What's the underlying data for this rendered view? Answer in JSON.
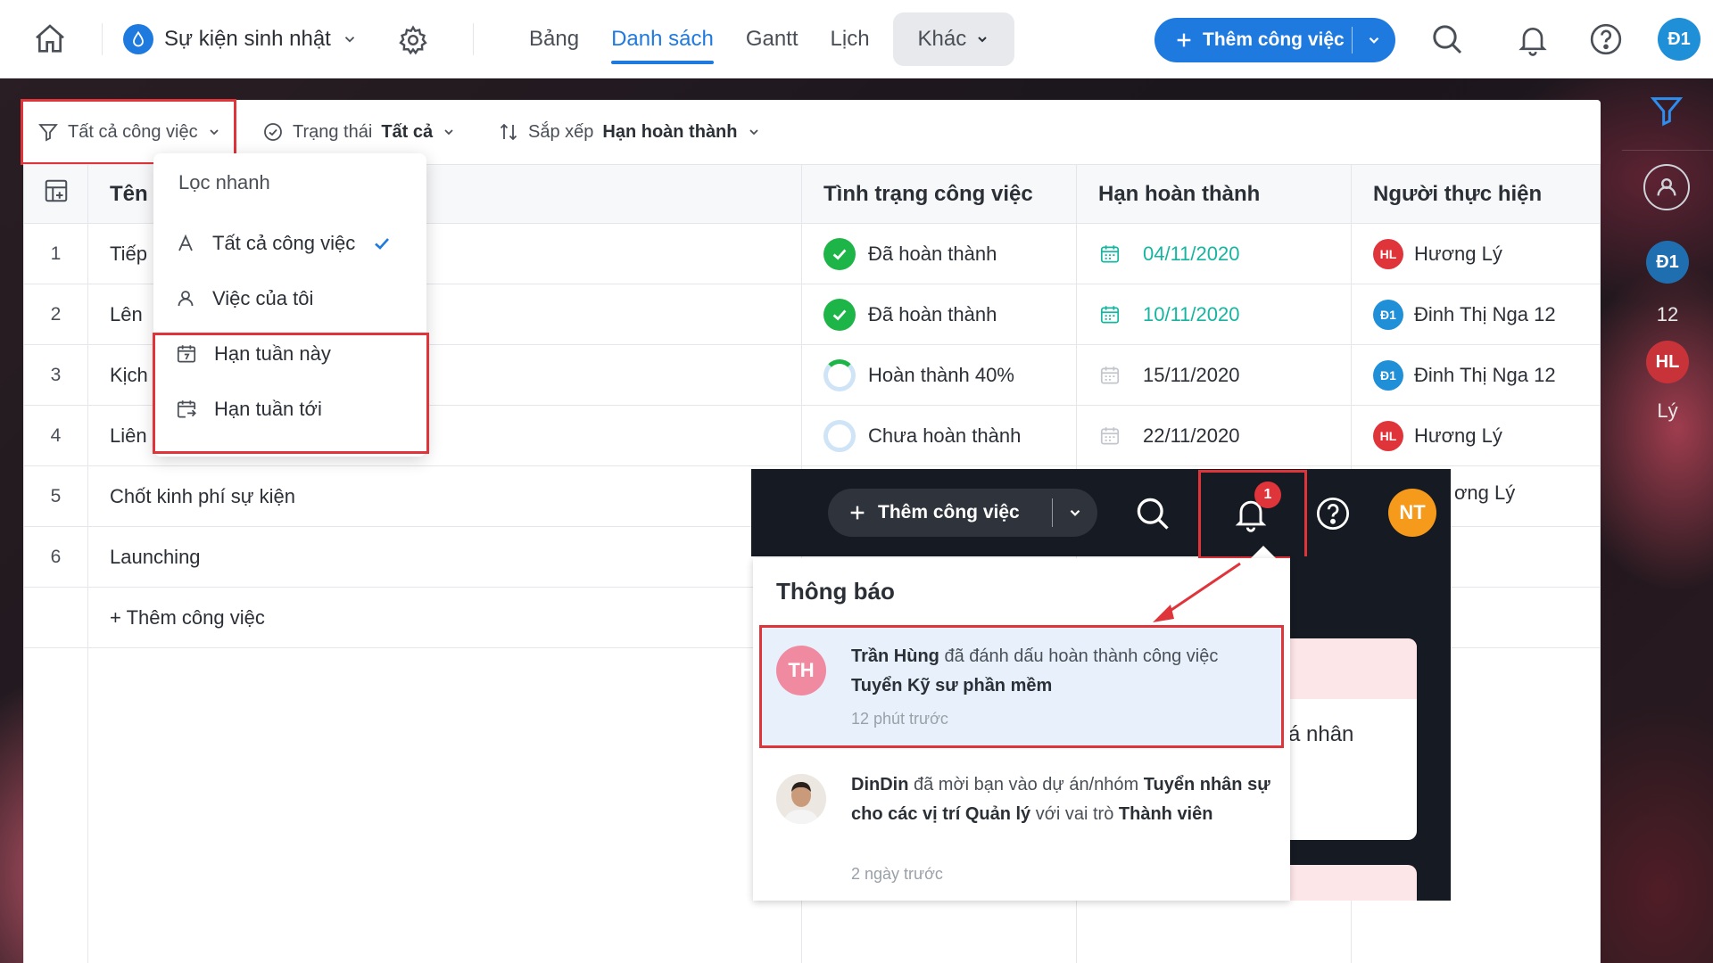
{
  "topbar": {
    "project_name": "Sự kiện sinh nhật",
    "views": [
      "Bảng",
      "Danh sách",
      "Gantt",
      "Lịch"
    ],
    "active_view": "Danh sách",
    "more_label": "Khác",
    "add_task_label": "Thêm công việc",
    "user_initials": "Đ1",
    "accent_color": "#1f7ae0"
  },
  "toolbar": {
    "filter_label": "Tất cả công việc",
    "status_prefix": "Trạng thái",
    "status_value": "Tất cả",
    "sort_prefix": "Sắp xếp",
    "sort_value": "Hạn hoàn thành"
  },
  "table": {
    "columns": {
      "name": "Tên",
      "status": "Tình trạng công việc",
      "due": "Hạn hoàn thành",
      "assignee": "Người thực hiện"
    },
    "rows": [
      {
        "num": "1",
        "name": "Tiếp",
        "status": "Đã hoàn thành",
        "state": "done",
        "due": "04/11/2020",
        "assignee": "Hương Lý",
        "initials": "HL",
        "color": "#e0343b"
      },
      {
        "num": "2",
        "name": "Lên",
        "status": "Đã hoàn thành",
        "state": "done",
        "due": "10/11/2020",
        "assignee": "Đinh Thị Nga 12",
        "initials": "Đ1",
        "color": "#1f8fd8"
      },
      {
        "num": "3",
        "name": "Kịch",
        "status": "Hoàn thành 40%",
        "state": "partial",
        "due": "15/11/2020",
        "assignee": "Đinh Thị Nga 12",
        "initials": "Đ1",
        "color": "#1f8fd8"
      },
      {
        "num": "4",
        "name": "Liên",
        "status": "Chưa hoàn thành",
        "state": "none",
        "due": "22/11/2020",
        "assignee": "Hương Lý",
        "initials": "HL",
        "color": "#e0343b"
      },
      {
        "num": "5",
        "name": "Chốt kinh phí sự kiện"
      },
      {
        "num": "6",
        "name": "Launching"
      }
    ],
    "add_task_link": "+ Thêm công việc"
  },
  "quick_filter": {
    "title": "Lọc nhanh",
    "items": [
      "Tất cả công việc",
      "Việc của tôi",
      "Hạn tuần này",
      "Hạn tuần tới"
    ]
  },
  "rail": {
    "av1_initials": "Đ1",
    "av1_label": "12",
    "av2_initials": "HL",
    "av2_label": "Lý"
  },
  "overlay": {
    "add_task_label": "Thêm công việc",
    "badge_count": "1",
    "user_initials": "NT",
    "peek_assignee": "ơng Lý",
    "peek_text": "á nhân"
  },
  "notifications": {
    "title": "Thông báo",
    "items": [
      {
        "initials": "TH",
        "actor": "Trần Hùng",
        "action": " đã đánh dấu hoàn thành công việc ",
        "target": "Tuyển Kỹ sư phần mềm",
        "time": "12 phút trước"
      },
      {
        "actor": "DinDin",
        "action": " đã mời bạn vào dự án/nhóm ",
        "target": "Tuyển nhân sự cho các vị trí Quản lý",
        "action2": " với vai trò ",
        "role": "Thành viên",
        "time": "2 ngày trước"
      }
    ]
  }
}
